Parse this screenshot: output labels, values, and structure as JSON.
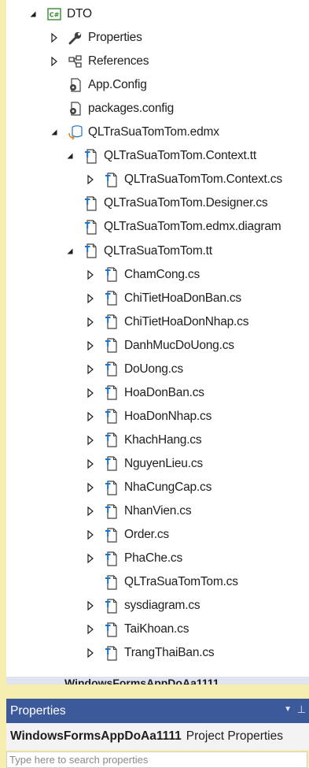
{
  "solution_tree": {
    "items": [
      {
        "label": "DTO",
        "indent": 0,
        "toggle": "expanded",
        "icon": "csharp-project-icon"
      },
      {
        "label": "Properties",
        "indent": 1,
        "toggle": "collapsed",
        "icon": "wrench-icon"
      },
      {
        "label": "References",
        "indent": 1,
        "toggle": "collapsed",
        "icon": "references-icon"
      },
      {
        "label": "App.Config",
        "indent": 1,
        "toggle": "none",
        "icon": "config-file-icon"
      },
      {
        "label": "packages.config",
        "indent": 1,
        "toggle": "none",
        "icon": "config-file-icon"
      },
      {
        "label": "QLTraSuaTomTom.edmx",
        "indent": 1,
        "toggle": "expanded",
        "icon": "edmx-icon"
      },
      {
        "label": "QLTraSuaTomTom.Context.tt",
        "indent": 2,
        "toggle": "expanded",
        "icon": "template-file-icon"
      },
      {
        "label": "QLTraSuaTomTom.Context.cs",
        "indent": 3,
        "toggle": "collapsed",
        "icon": "template-file-icon"
      },
      {
        "label": "QLTraSuaTomTom.Designer.cs",
        "indent": 2,
        "toggle": "none",
        "icon": "template-file-icon"
      },
      {
        "label": "QLTraSuaTomTom.edmx.diagram",
        "indent": 2,
        "toggle": "none",
        "icon": "template-file-icon"
      },
      {
        "label": "QLTraSuaTomTom.tt",
        "indent": 2,
        "toggle": "expanded",
        "icon": "template-file-icon"
      },
      {
        "label": "ChamCong.cs",
        "indent": 3,
        "toggle": "collapsed",
        "icon": "template-file-icon"
      },
      {
        "label": "ChiTietHoaDonBan.cs",
        "indent": 3,
        "toggle": "collapsed",
        "icon": "template-file-icon"
      },
      {
        "label": "ChiTietHoaDonNhap.cs",
        "indent": 3,
        "toggle": "collapsed",
        "icon": "template-file-icon"
      },
      {
        "label": "DanhMucDoUong.cs",
        "indent": 3,
        "toggle": "collapsed",
        "icon": "template-file-icon"
      },
      {
        "label": "DoUong.cs",
        "indent": 3,
        "toggle": "collapsed",
        "icon": "template-file-icon"
      },
      {
        "label": "HoaDonBan.cs",
        "indent": 3,
        "toggle": "collapsed",
        "icon": "template-file-icon"
      },
      {
        "label": "HoaDonNhap.cs",
        "indent": 3,
        "toggle": "collapsed",
        "icon": "template-file-icon"
      },
      {
        "label": "KhachHang.cs",
        "indent": 3,
        "toggle": "collapsed",
        "icon": "template-file-icon"
      },
      {
        "label": "NguyenLieu.cs",
        "indent": 3,
        "toggle": "collapsed",
        "icon": "template-file-icon"
      },
      {
        "label": "NhaCungCap.cs",
        "indent": 3,
        "toggle": "collapsed",
        "icon": "template-file-icon"
      },
      {
        "label": "NhanVien.cs",
        "indent": 3,
        "toggle": "collapsed",
        "icon": "template-file-icon"
      },
      {
        "label": "Order.cs",
        "indent": 3,
        "toggle": "collapsed",
        "icon": "template-file-icon"
      },
      {
        "label": "PhaChe.cs",
        "indent": 3,
        "toggle": "collapsed",
        "icon": "template-file-icon"
      },
      {
        "label": "QLTraSuaTomTom.cs",
        "indent": 3,
        "toggle": "none",
        "icon": "template-file-icon"
      },
      {
        "label": "sysdiagram.cs",
        "indent": 3,
        "toggle": "collapsed",
        "icon": "template-file-icon"
      },
      {
        "label": "TaiKhoan.cs",
        "indent": 3,
        "toggle": "collapsed",
        "icon": "template-file-icon"
      },
      {
        "label": "TrangThaiBan.cs",
        "indent": 3,
        "toggle": "collapsed",
        "icon": "template-file-icon"
      }
    ],
    "partial_next_project": "WindowsFormsAppDoAa1111"
  },
  "properties_panel": {
    "title": "Properties",
    "object_name": "WindowsFormsAppDoAa1111",
    "object_kind": "Project Properties",
    "search_placeholder": "Type here to search properties"
  },
  "colors": {
    "title_bar": "#3c5a9a",
    "background_outside": "#f6eeb0"
  }
}
